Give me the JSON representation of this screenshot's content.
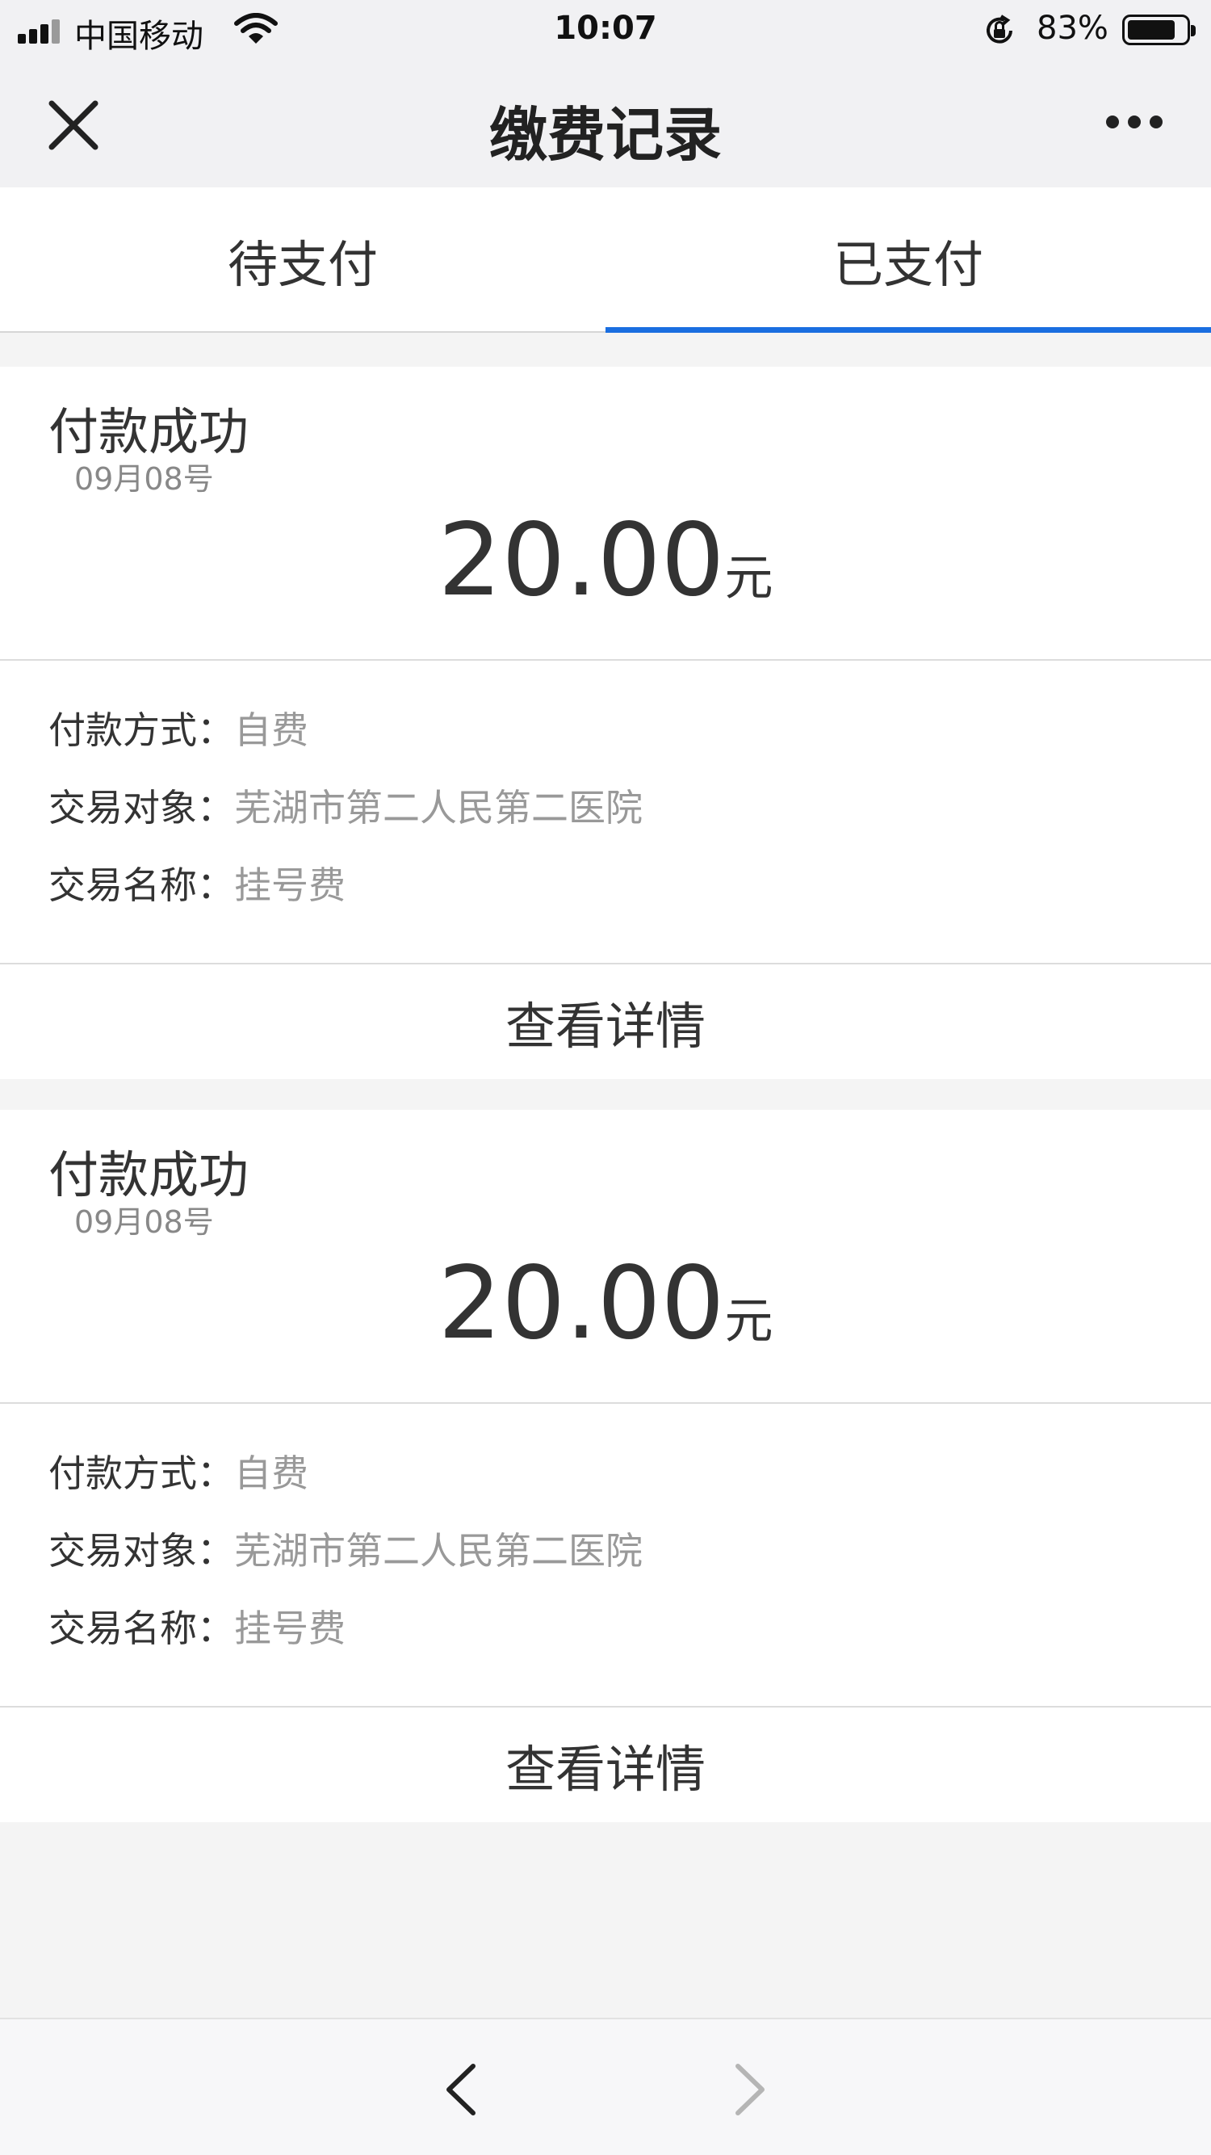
{
  "status_bar": {
    "carrier": "中国移动",
    "time": "10:07",
    "battery_pct": "83%",
    "battery_level": 0.83,
    "icons": [
      "signal-icon",
      "wifi-icon",
      "rotation-lock-icon",
      "battery-icon"
    ]
  },
  "nav": {
    "title": "缴费记录",
    "close_icon": "close-icon",
    "more_icon": "more-icon"
  },
  "tabs": [
    {
      "label": "待支付",
      "active": false
    },
    {
      "label": "已支付",
      "active": true
    }
  ],
  "colors": {
    "accent": "#1a6ee0",
    "text": "#333333",
    "muted": "#999999",
    "background": "#f4f4f4"
  },
  "records": [
    {
      "status": "付款成功",
      "date": "09月08号",
      "amount": "20.00",
      "unit": "元",
      "pay_method_label": "付款方式：",
      "pay_method": "自费",
      "target_label": "交易对象：",
      "target": "芜湖市第二人民第二医院",
      "name_label": "交易名称：",
      "name": "挂号费",
      "detail_button": "查看详情"
    },
    {
      "status": "付款成功",
      "date": "09月08号",
      "amount": "20.00",
      "unit": "元",
      "pay_method_label": "付款方式：",
      "pay_method": "自费",
      "target_label": "交易对象：",
      "target": "芜湖市第二人民第二医院",
      "name_label": "交易名称：",
      "name": "挂号费",
      "detail_button": "查看详情"
    }
  ],
  "toolbar": {
    "back_icon": "chevron-left-icon",
    "forward_icon": "chevron-right-icon",
    "forward_enabled": false
  }
}
